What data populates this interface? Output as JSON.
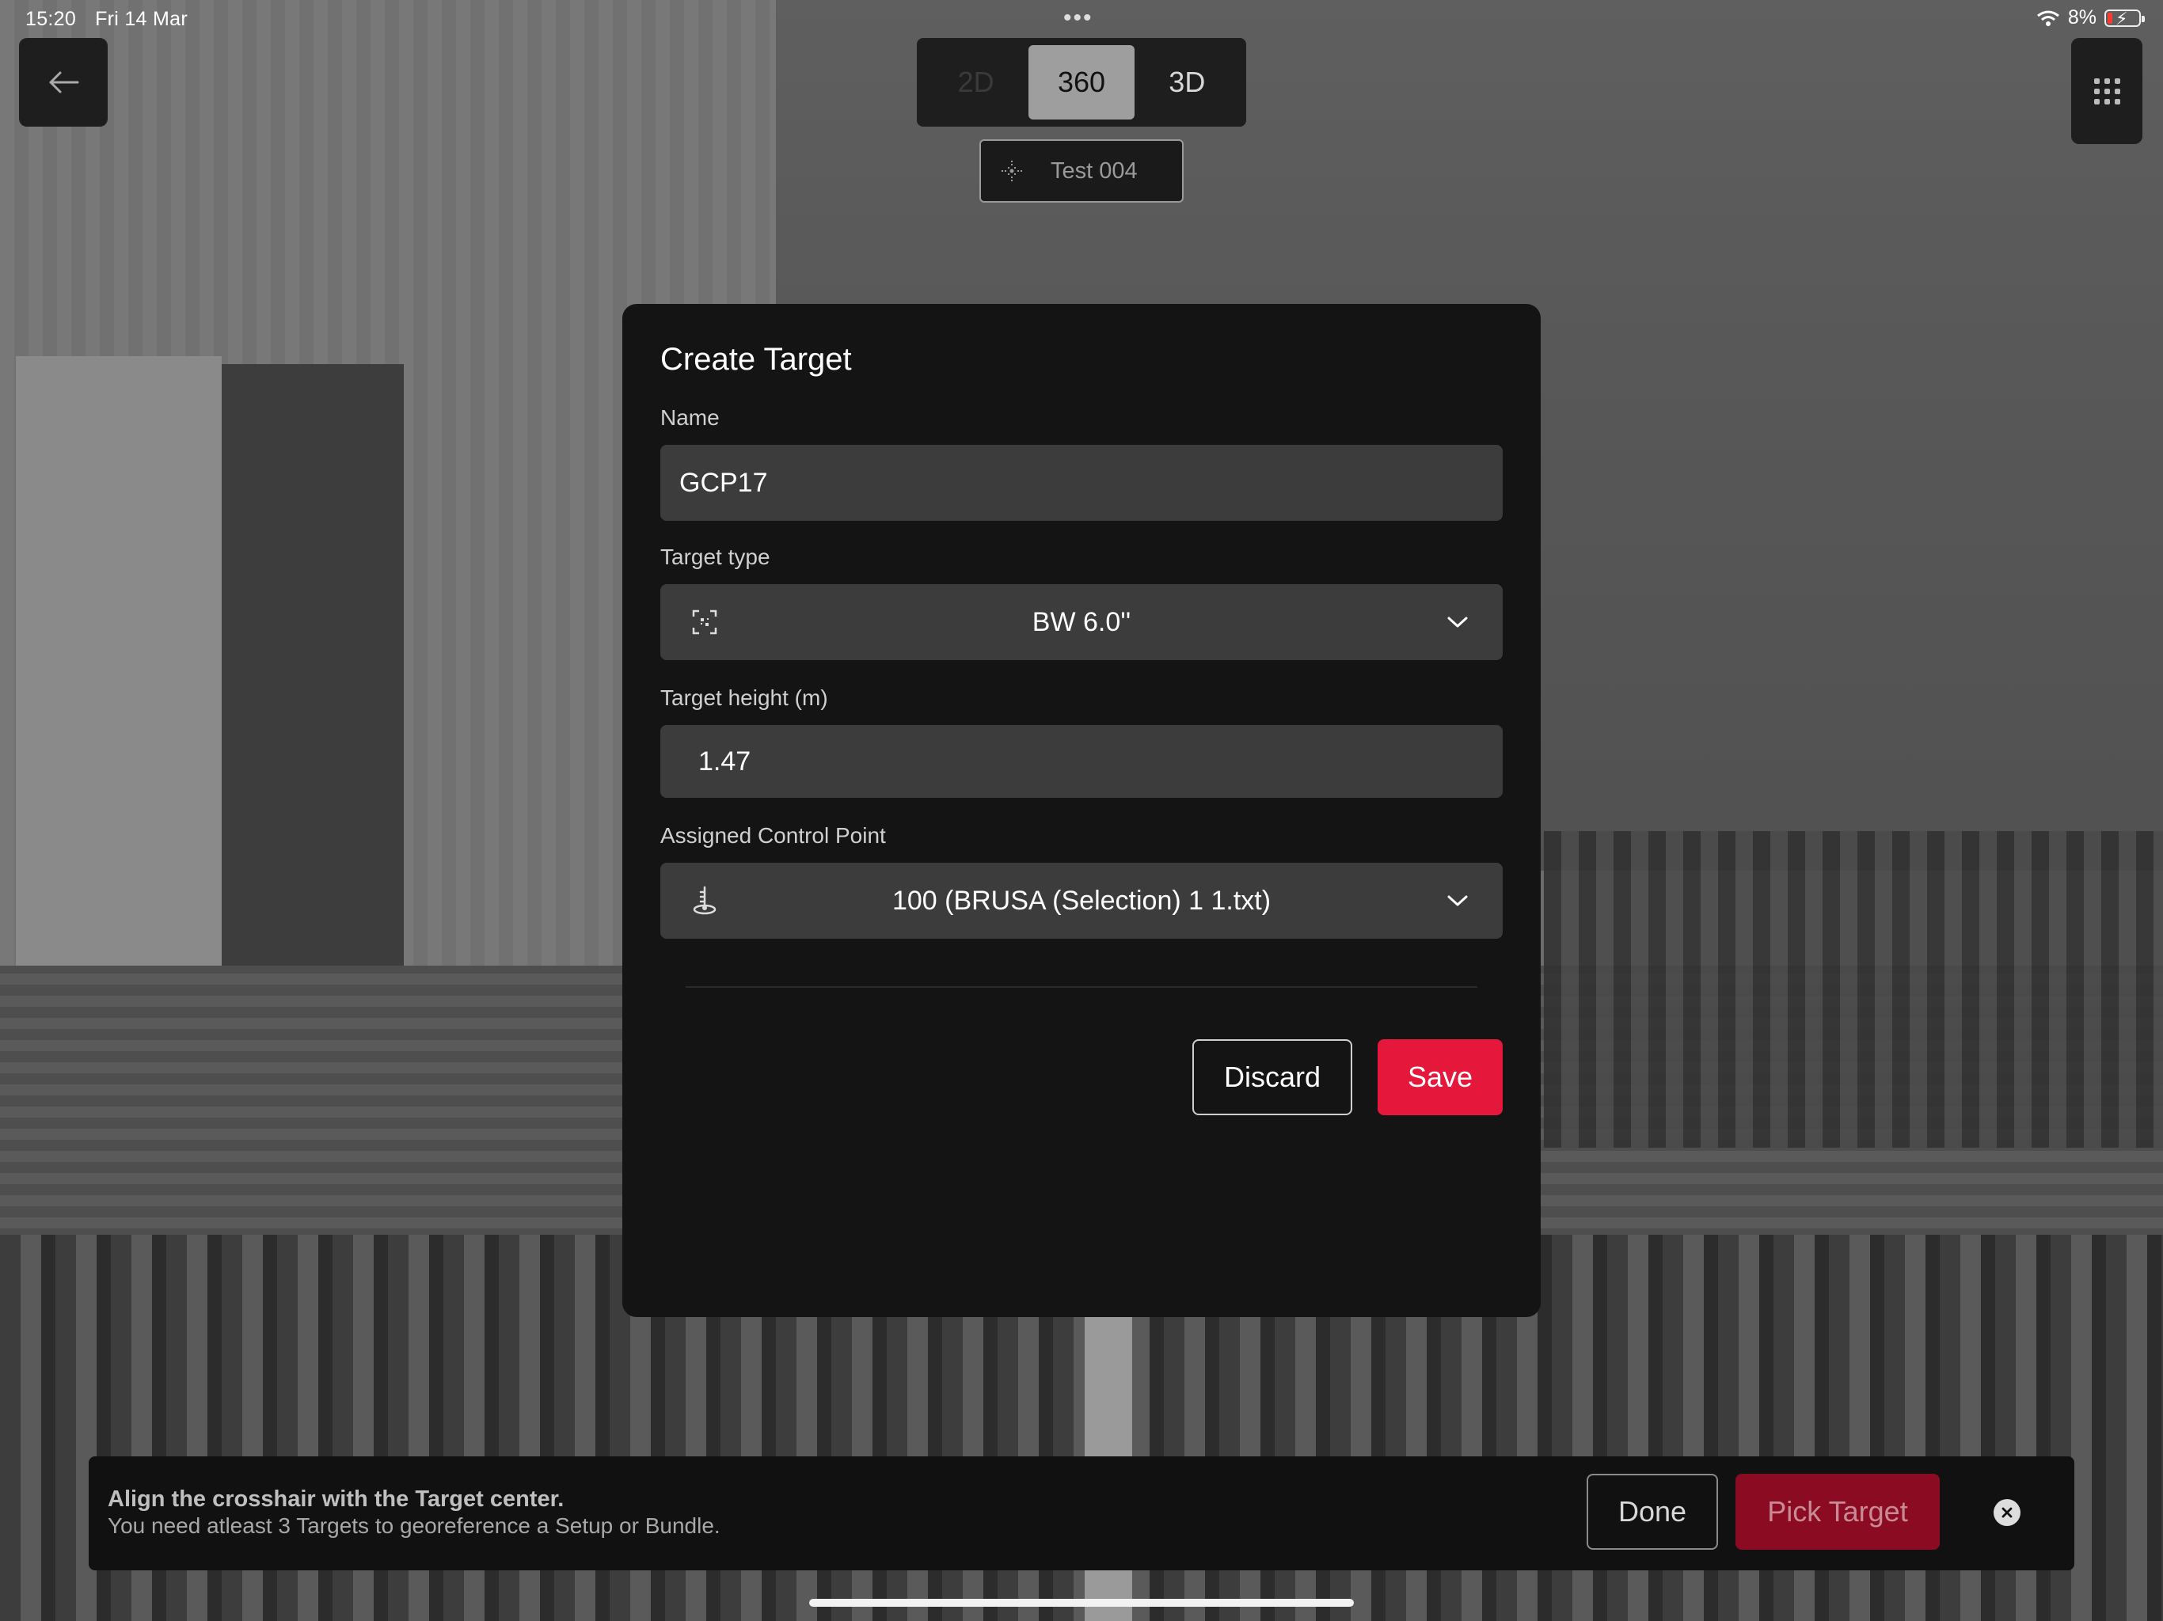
{
  "status_bar": {
    "time": "15:20",
    "date": "Fri 14 Mar",
    "battery": "8%",
    "dots": "•••"
  },
  "mode_switch": {
    "options": [
      "2D",
      "360",
      "3D"
    ],
    "selected": "360"
  },
  "project_chip": {
    "label": "Test 004"
  },
  "modal": {
    "title": "Create Target",
    "name": {
      "label": "Name",
      "value": "GCP17"
    },
    "target_type": {
      "label": "Target type",
      "value": "BW 6.0''"
    },
    "target_height": {
      "label": "Target height (m)",
      "value": "1.47"
    },
    "control_point": {
      "label": "Assigned Control Point",
      "value": "100 (BRUSA (Selection) 1 1.txt)"
    },
    "discard_label": "Discard",
    "save_label": "Save"
  },
  "hint_bar": {
    "title": "Align the crosshair with the Target center.",
    "subtitle": "You need atleast 3 Targets to georeference a Setup or Bundle.",
    "done_label": "Done",
    "pick_label": "Pick Target"
  },
  "colors": {
    "accent": "#e5183b",
    "accent_dim": "#8b0b22",
    "panel": "#141414",
    "field": "#3c3c3c"
  },
  "icons": [
    "back-arrow-icon",
    "app-grid-icon",
    "move-crosshair-icon",
    "target-scan-icon",
    "chevron-down-icon",
    "survey-point-icon",
    "close-circle-icon",
    "wifi-icon",
    "battery-icon"
  ]
}
